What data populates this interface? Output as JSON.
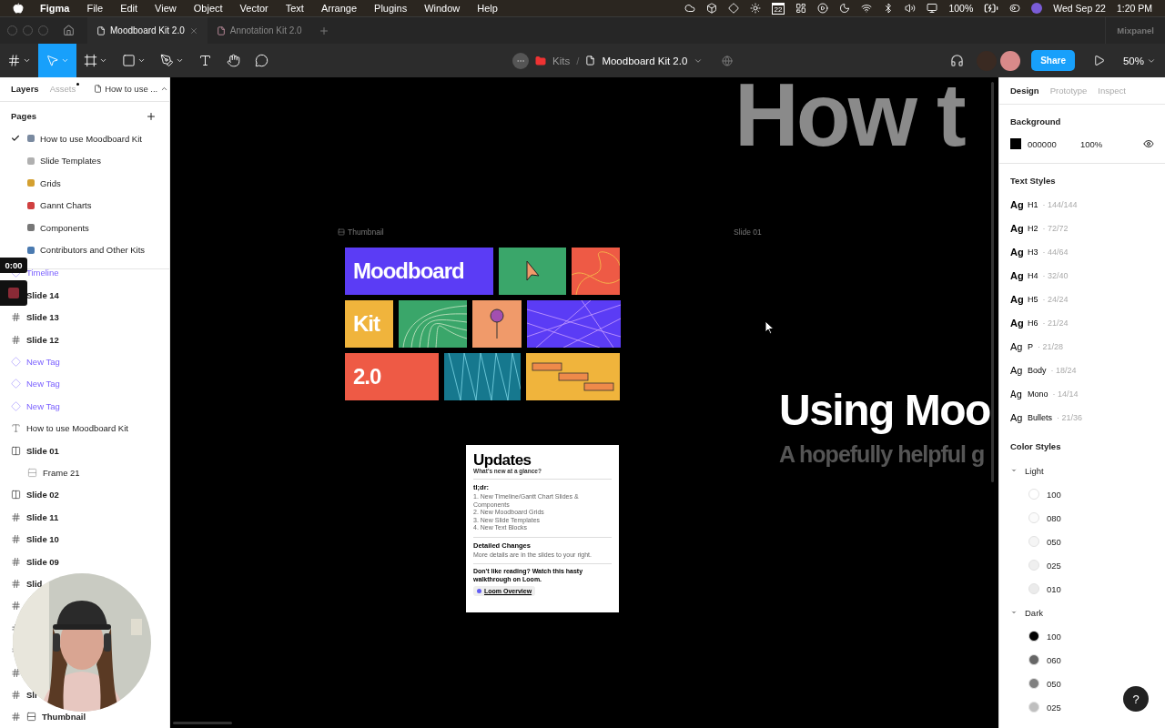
{
  "menu_bar": {
    "app": "Figma",
    "items": [
      "File",
      "Edit",
      "View",
      "Object",
      "Vector",
      "Text",
      "Arrange",
      "Plugins",
      "Window",
      "Help"
    ],
    "calendar_day": "22",
    "battery": "100%",
    "date": "Wed Sep 22",
    "time": "1:20 PM"
  },
  "tab_bar": {
    "tabs": [
      {
        "label": "Moodboard Kit 2.0",
        "selected": true
      },
      {
        "label": "Annotation Kit 2.0",
        "selected": false
      }
    ],
    "team": "Mixpanel"
  },
  "toolbar": {
    "tools": [
      {
        "kind": "move",
        "selected": true
      },
      {
        "kind": "frame",
        "selected": false
      },
      {
        "kind": "shape",
        "selected": false
      },
      {
        "kind": "pen",
        "selected": false
      },
      {
        "kind": "text",
        "selected": false
      },
      {
        "kind": "hand",
        "selected": false
      },
      {
        "kind": "comment",
        "selected": false
      }
    ],
    "project": "Kits",
    "separator": "/",
    "file": "Moodboard Kit 2.0",
    "share": "Share",
    "zoom": "50%"
  },
  "left_panel": {
    "tabs": [
      {
        "label": "Layers",
        "selected": true
      },
      {
        "label": "Assets",
        "selected": false
      }
    ],
    "page_selector": "How to use ...",
    "pages_heading": "Pages",
    "pages": [
      {
        "name": "How to use Moodboard Kit",
        "selected": true,
        "color": "#7a8aa0"
      },
      {
        "name": "Slide Templates",
        "selected": false,
        "color": "#b0b0b0"
      },
      {
        "name": "Grids",
        "selected": false,
        "color": "#d4a030"
      },
      {
        "name": "Gannt Charts",
        "selected": false,
        "color": "#d04040"
      },
      {
        "name": "Components",
        "selected": false,
        "color": "#777777"
      },
      {
        "name": "Contributors and Other Kits",
        "selected": false,
        "color": "#4a7ab0"
      }
    ],
    "layers": [
      {
        "kind": "instance",
        "name": "Timeline"
      },
      {
        "kind": "frame",
        "name": "Slide 14"
      },
      {
        "kind": "frame",
        "name": "Slide 13"
      },
      {
        "kind": "frame",
        "name": "Slide 12"
      },
      {
        "kind": "instance",
        "name": "New Tag"
      },
      {
        "kind": "instance",
        "name": "New Tag"
      },
      {
        "kind": "instance",
        "name": "New Tag"
      },
      {
        "kind": "text",
        "name": "How to use Moodboard Kit"
      },
      {
        "kind": "columns",
        "name": "Slide 01",
        "children": [
          {
            "kind": "rows",
            "name": "Frame 21"
          }
        ]
      },
      {
        "kind": "columns",
        "name": "Slide 02"
      },
      {
        "kind": "frame",
        "name": "Slide 11"
      },
      {
        "kind": "frame",
        "name": "Slide 10"
      },
      {
        "kind": "frame",
        "name": "Slide 09"
      },
      {
        "kind": "frame",
        "name": "Slid"
      },
      {
        "kind": "frame"
      },
      {
        "kind": "frame"
      },
      {
        "kind": "frame"
      },
      {
        "kind": "frame"
      },
      {
        "kind": "frame",
        "name": "Sli"
      },
      {
        "kind": "frame-rows",
        "name": "Thumbnail"
      }
    ]
  },
  "recording": {
    "time": "0:00"
  },
  "canvas": {
    "heading_top": "How t",
    "frame_labels": [
      "Thumbnail",
      "Slide 01"
    ],
    "thumbnail": {
      "rows": [
        [
          {
            "kind": "text",
            "label": "Moodboard",
            "color": "#5b3cf5"
          },
          {
            "kind": "cursor",
            "color": "#3aa66a"
          },
          {
            "kind": "curves",
            "color": "#ee5a45"
          }
        ],
        [
          {
            "kind": "text",
            "label": "Kit",
            "color": "#f0b43c"
          },
          {
            "kind": "arcs",
            "color": "#3aa66a"
          },
          {
            "kind": "pin",
            "color": "#f09a6a"
          },
          {
            "kind": "lines",
            "color": "#5b3cf5"
          }
        ],
        [
          {
            "kind": "text",
            "label": "2.0",
            "color": "#ee5a45"
          },
          {
            "kind": "zigzag",
            "color": "#16788e"
          },
          {
            "kind": "bars",
            "color": "#f0b43c"
          }
        ]
      ]
    },
    "updates_card": {
      "title": "Updates",
      "subtitle": "What's new at a glance?",
      "tldr": "tl;dr:",
      "items": [
        "1. New Timeline/Gantt Chart Slides & Components",
        "2. New Moodboard Grids",
        "3. New Slide Templates",
        "4. New Text Blocks"
      ],
      "details_heading": "Detailed Changes",
      "details": "More details are in the slides to your right.",
      "footer": "Don't like reading? Watch this hasty walkthrough on Loom.",
      "link": "Loom Overview"
    },
    "slide_title": "Using Moo",
    "slide_subtitle": "A hopefully helpful g"
  },
  "right_panel": {
    "tabs": [
      {
        "label": "Design",
        "selected": true
      },
      {
        "label": "Prototype",
        "selected": false
      },
      {
        "label": "Inspect",
        "selected": false
      }
    ],
    "background": {
      "heading": "Background",
      "hex": "000000",
      "opacity": "100%",
      "color": "#000000"
    },
    "text_styles_heading": "Text Styles",
    "text_styles": [
      {
        "sample": "Ag",
        "kind": "heading",
        "name": "H1",
        "spec": "· 144/144"
      },
      {
        "sample": "Ag",
        "kind": "heading",
        "name": "H2",
        "spec": "· 72/72"
      },
      {
        "sample": "Ag",
        "kind": "heading",
        "name": "H3",
        "spec": "· 44/64"
      },
      {
        "sample": "Ag",
        "kind": "heading",
        "name": "H4",
        "spec": "· 32/40"
      },
      {
        "sample": "Ag",
        "kind": "heading",
        "name": "H5",
        "spec": "· 24/24"
      },
      {
        "sample": "Ag",
        "kind": "heading",
        "name": "H6",
        "spec": "· 21/24"
      },
      {
        "sample": "Ag",
        "kind": "body",
        "name": "P",
        "spec": "· 21/28"
      },
      {
        "sample": "Ag",
        "kind": "body",
        "name": "Body",
        "spec": "· 18/24"
      },
      {
        "sample": "Ag",
        "kind": "mono",
        "name": "Mono",
        "spec": "· 14/14"
      },
      {
        "sample": "Ag",
        "kind": "body",
        "name": "Bullets",
        "spec": "· 21/36"
      }
    ],
    "color_styles_heading": "Color Styles",
    "color_groups": [
      {
        "name": "Light",
        "expanded": true,
        "swatches": [
          {
            "name": "100",
            "color": "#ffffff"
          },
          {
            "name": "080",
            "color": "#fbfbfb"
          },
          {
            "name": "050",
            "color": "#f5f5f5"
          },
          {
            "name": "025",
            "color": "#efefef"
          },
          {
            "name": "010",
            "color": "#ebebeb"
          }
        ]
      },
      {
        "name": "Dark",
        "expanded": true,
        "swatches": [
          {
            "name": "100",
            "color": "#000000"
          },
          {
            "name": "060",
            "color": "#666666"
          },
          {
            "name": "050",
            "color": "#808080"
          },
          {
            "name": "025",
            "color": "#bfbfbf"
          }
        ]
      }
    ],
    "help": "?"
  }
}
